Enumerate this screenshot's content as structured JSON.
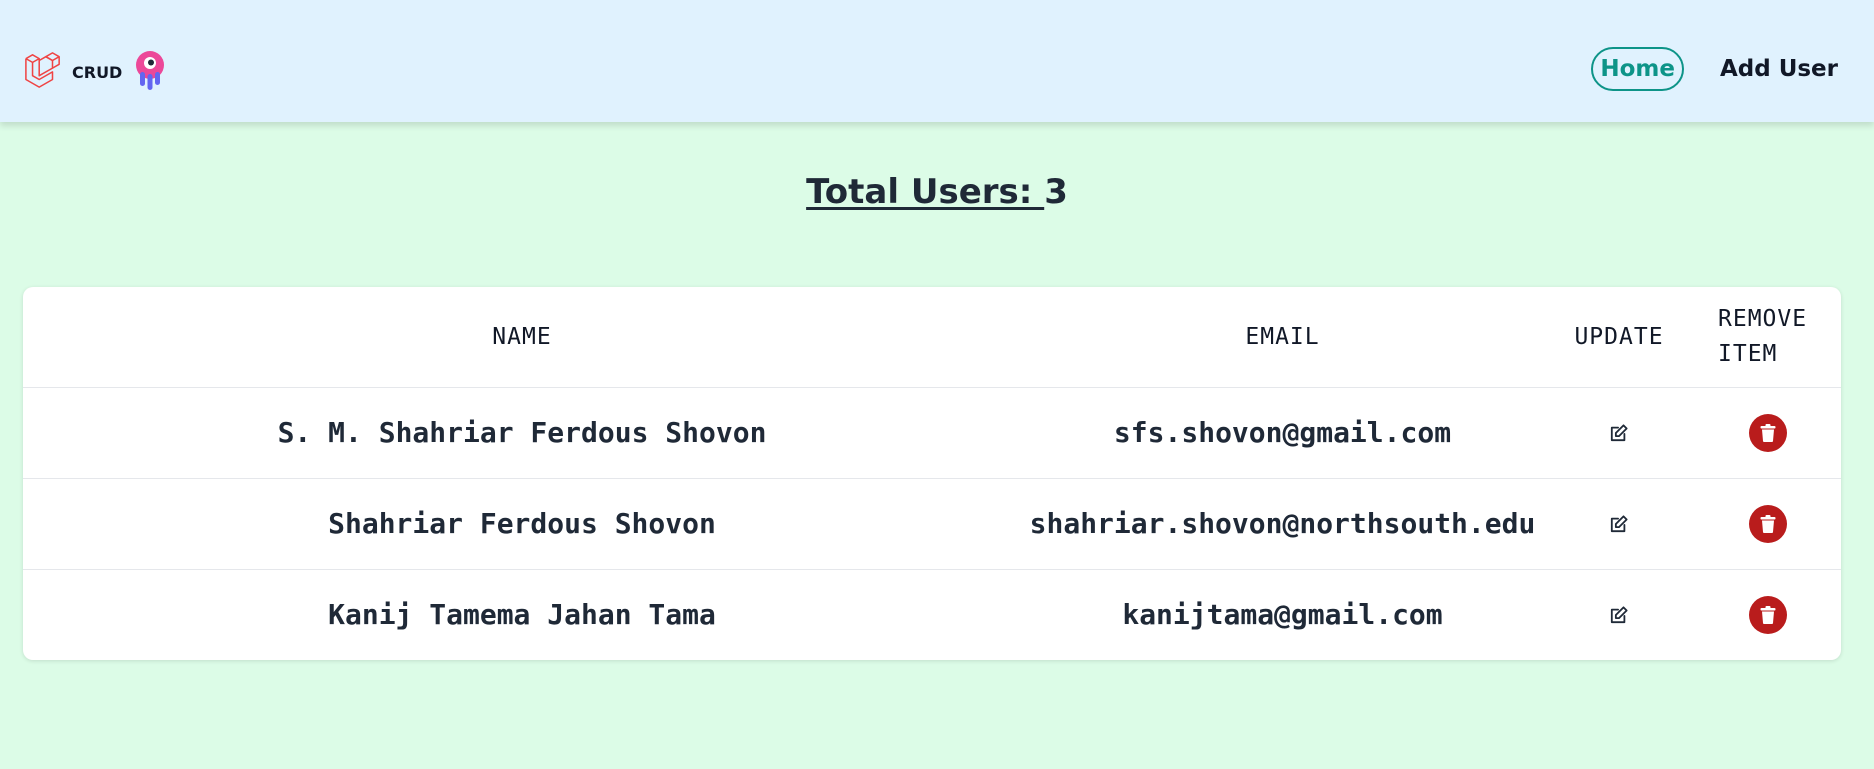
{
  "navbar": {
    "brand_text": "CRUD",
    "links": {
      "home": "Home",
      "add_user": "Add User"
    }
  },
  "summary": {
    "label": "Total Users: ",
    "count": "3"
  },
  "table": {
    "headers": {
      "name": "NAME",
      "email": "EMAIL",
      "update": "UPDATE",
      "remove_line1": "REMOVE",
      "remove_line2": "ITEM"
    },
    "rows": [
      {
        "name": "S. M. Shahriar Ferdous Shovon",
        "email": "sfs.shovon@gmail.com"
      },
      {
        "name": "Shahriar Ferdous Shovon",
        "email": "shahriar.shovon@northsouth.edu"
      },
      {
        "name": "Kanij Tamema Jahan Tama",
        "email": "kanijtama@gmail.com"
      }
    ]
  },
  "icons": {
    "brand_logo": "laravel-logo-icon",
    "brand_mascot": "livewire-mascot-icon",
    "update": "edit-icon",
    "remove": "trash-icon"
  },
  "colors": {
    "navbar_bg": "#e0f2fe",
    "page_bg": "#dcfce7",
    "accent": "#0d9488",
    "danger": "#b91c1c"
  }
}
